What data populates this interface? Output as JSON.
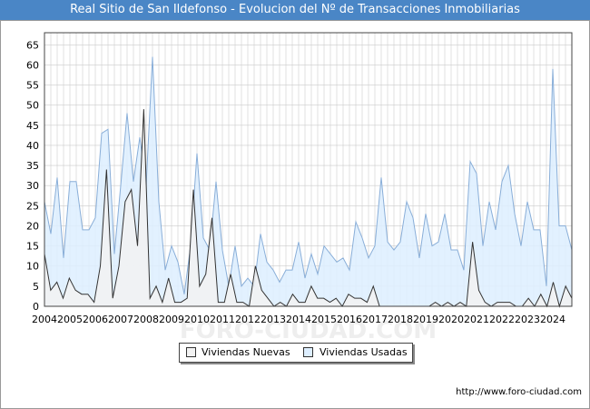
{
  "header": {
    "title": "Real Sitio de San Ildefonso - Evolucion del Nº de Transacciones Inmobiliarias"
  },
  "footer": {
    "url": "http://www.foro-ciudad.com"
  },
  "watermark": "FORO-CIUDAD.COM",
  "colors": {
    "title_bg": "#4a86c6",
    "nuevas_fill": "#f2f2f2",
    "nuevas_line": "#333333",
    "usadas_fill": "#ddeeff",
    "usadas_line": "#89aed8",
    "grid": "#cccccc"
  },
  "chart_data": {
    "type": "area",
    "title": "Real Sitio de San Ildefonso - Evolucion del Nº de Transacciones Inmobiliarias",
    "x_tick_labels": [
      "2004",
      "2005",
      "2006",
      "2007",
      "2008",
      "2009",
      "2010",
      "2011",
      "2012",
      "2013",
      "2014",
      "2015",
      "2016",
      "2017",
      "2018",
      "2019",
      "2020",
      "2021",
      "2022",
      "2023",
      "2024"
    ],
    "xlim": [
      2004,
      2024.75
    ],
    "ylim": [
      0,
      68
    ],
    "y_ticks": [
      0,
      5,
      10,
      15,
      20,
      25,
      30,
      35,
      40,
      45,
      50,
      55,
      60,
      65
    ],
    "grid": true,
    "legend_position": "bottom",
    "series": [
      {
        "name": "Viviendas Nuevas",
        "values": [
          13,
          4,
          6,
          2,
          7,
          4,
          3,
          3,
          1,
          10,
          34,
          2,
          10,
          26,
          29,
          15,
          49,
          2,
          5,
          1,
          7,
          1,
          1,
          2,
          29,
          5,
          8,
          22,
          1,
          1,
          8,
          1,
          1,
          0,
          10,
          4,
          2,
          0,
          1,
          0,
          3,
          1,
          1,
          5,
          2,
          2,
          1,
          2,
          0,
          3,
          2,
          2,
          1,
          5,
          0,
          0,
          0,
          0,
          0,
          0,
          0,
          0,
          0,
          1,
          0,
          1,
          0,
          1,
          0,
          16,
          4,
          1,
          0,
          1,
          1,
          1,
          0,
          0,
          2,
          0,
          3,
          0,
          6,
          0,
          5,
          2
        ]
      },
      {
        "name": "Viviendas Usadas",
        "values": [
          26,
          18,
          32,
          12,
          31,
          31,
          19,
          19,
          22,
          43,
          44,
          13,
          30,
          48,
          31,
          42,
          30,
          62,
          26,
          9,
          15,
          11,
          3,
          15,
          38,
          17,
          14,
          31,
          14,
          5,
          15,
          5,
          7,
          5,
          18,
          11,
          9,
          6,
          9,
          9,
          16,
          7,
          13,
          8,
          15,
          13,
          11,
          12,
          9,
          21,
          17,
          12,
          15,
          32,
          16,
          14,
          16,
          26,
          22,
          12,
          23,
          15,
          16,
          23,
          14,
          14,
          9,
          36,
          33,
          15,
          26,
          19,
          31,
          35,
          23,
          15,
          26,
          19,
          19,
          5,
          59,
          20,
          20,
          14
        ]
      }
    ]
  }
}
